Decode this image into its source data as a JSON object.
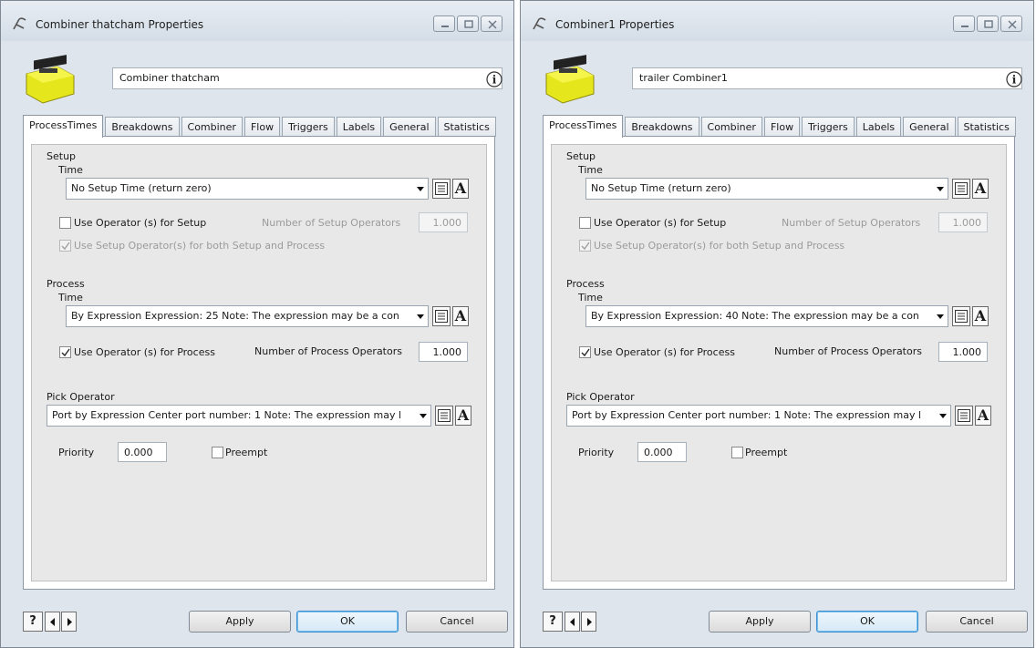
{
  "windows": [
    {
      "title": "Combiner thatcham  Properties",
      "object_name": "Combiner thatcham",
      "tabs": [
        "ProcessTimes",
        "Breakdowns",
        "Combiner",
        "Flow",
        "Triggers",
        "Labels",
        "General",
        "Statistics"
      ],
      "active_tab": "ProcessTimes",
      "setup": {
        "section_label": "Setup",
        "time_label": "Time",
        "time_value": "No Setup Time (return zero)",
        "use_operator_label": "Use Operator (s) for Setup",
        "use_operator_checked": false,
        "num_operators_label": "Number of Setup Operators",
        "num_operators_value": "1.000",
        "both_label": "Use Setup Operator(s) for both Setup and Process",
        "both_checked": true
      },
      "process": {
        "section_label": "Process",
        "time_label": "Time",
        "time_value": "By Expression Expression: 25 Note: The expression may be a con",
        "use_operator_label": "Use Operator (s) for Process",
        "use_operator_checked": true,
        "num_operators_label": "Number of Process Operators",
        "num_operators_value": "1.000"
      },
      "pick_operator": {
        "label": "Pick Operator",
        "value": "Port by Expression Center port number: 1 Note: The expression may l"
      },
      "priority": {
        "label": "Priority",
        "value": "0.000"
      },
      "preempt": {
        "label": "Preempt",
        "checked": false
      },
      "buttons": {
        "apply": "Apply",
        "ok": "OK",
        "cancel": "Cancel"
      }
    },
    {
      "title": "Combiner1  Properties",
      "object_name": "trailer Combiner1",
      "tabs": [
        "ProcessTimes",
        "Breakdowns",
        "Combiner",
        "Flow",
        "Triggers",
        "Labels",
        "General",
        "Statistics"
      ],
      "active_tab": "ProcessTimes",
      "setup": {
        "section_label": "Setup",
        "time_label": "Time",
        "time_value": "No Setup Time (return zero)",
        "use_operator_label": "Use Operator (s) for Setup",
        "use_operator_checked": false,
        "num_operators_label": "Number of Setup Operators",
        "num_operators_value": "1.000",
        "both_label": "Use Setup Operator(s) for both Setup and Process",
        "both_checked": true
      },
      "process": {
        "section_label": "Process",
        "time_label": "Time",
        "time_value": "By Expression Expression: 40 Note: The expression may be a con",
        "use_operator_label": "Use Operator (s) for Process",
        "use_operator_checked": true,
        "num_operators_label": "Number of Process Operators",
        "num_operators_value": "1.000"
      },
      "pick_operator": {
        "label": "Pick Operator",
        "value": "Port by Expression Center port number: 1 Note: The expression may l"
      },
      "priority": {
        "label": "Priority",
        "value": "0.000"
      },
      "preempt": {
        "label": "Preempt",
        "checked": false
      },
      "buttons": {
        "apply": "Apply",
        "ok": "OK",
        "cancel": "Cancel"
      }
    }
  ],
  "icons": {
    "app": "flexsim-app-icon",
    "object": "combiner-object-icon",
    "info": "info-icon",
    "code": "code-edit-icon",
    "template": "text-template-icon",
    "help": "help-icon",
    "prev": "prev-arrow-icon",
    "next": "next-arrow-icon"
  },
  "colors": {
    "object_yellow": "#e8e81a",
    "default_button_border": "#3c90d2",
    "window_bg": "#dfe5ec"
  }
}
